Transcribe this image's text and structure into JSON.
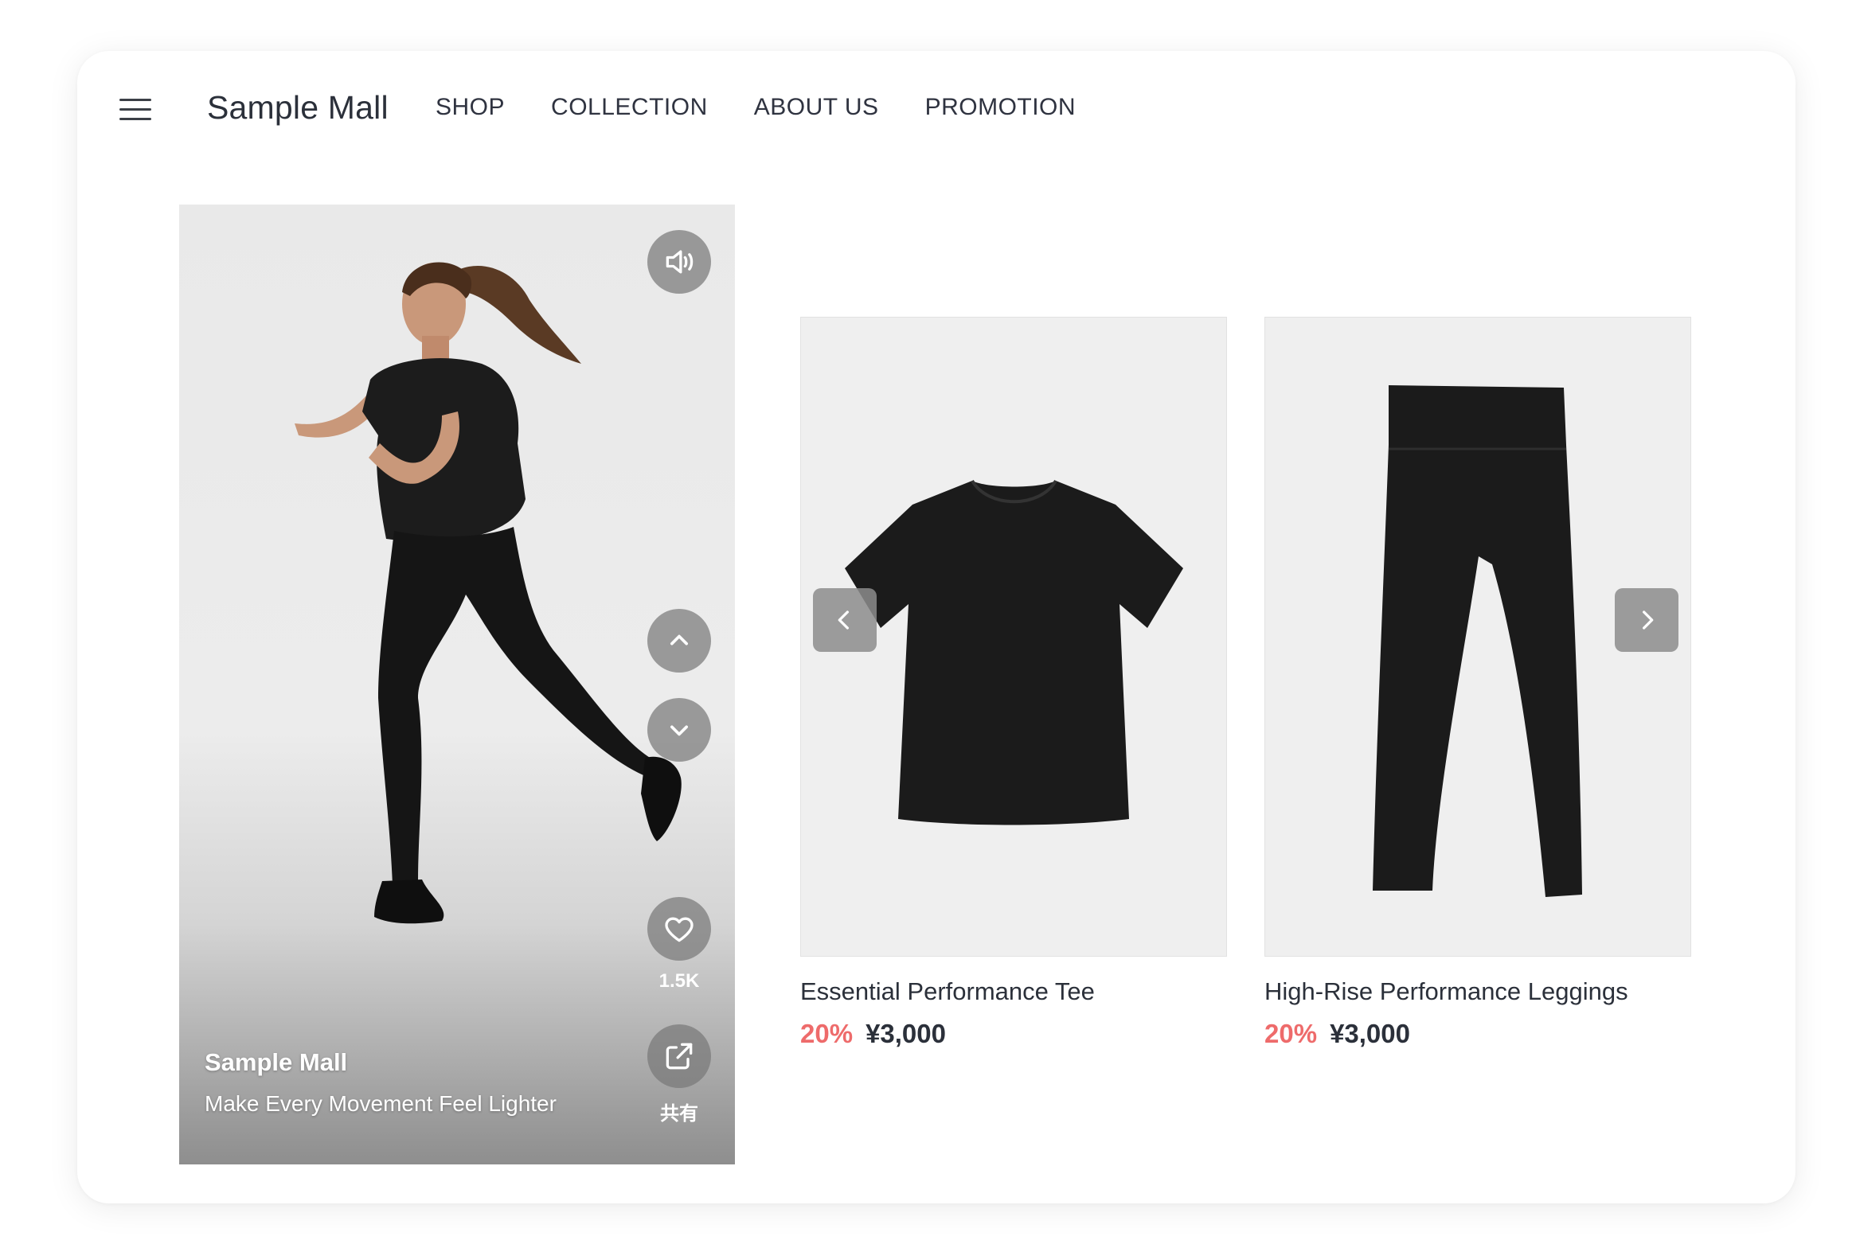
{
  "header": {
    "brand": "Sample Mall",
    "nav": [
      "SHOP",
      "COLLECTION",
      "ABOUT US",
      "PROMOTION"
    ]
  },
  "video": {
    "brand": "Sample Mall",
    "tagline": "Make Every Movement Feel Lighter",
    "likes": "1.5K",
    "share_label": "共有",
    "icons": [
      "volume-icon",
      "chevron-up-icon",
      "chevron-down-icon",
      "heart-icon",
      "share-icon"
    ]
  },
  "products": [
    {
      "name": "Essential Performance Tee",
      "discount": "20%",
      "price": "¥3,000"
    },
    {
      "name": "High-Rise Performance Leggings",
      "discount": "20%",
      "price": "¥3,000"
    }
  ],
  "colors": {
    "discount": "#ee6b6b",
    "text": "#2b303a",
    "overlay_button": "#7a7a7a"
  }
}
